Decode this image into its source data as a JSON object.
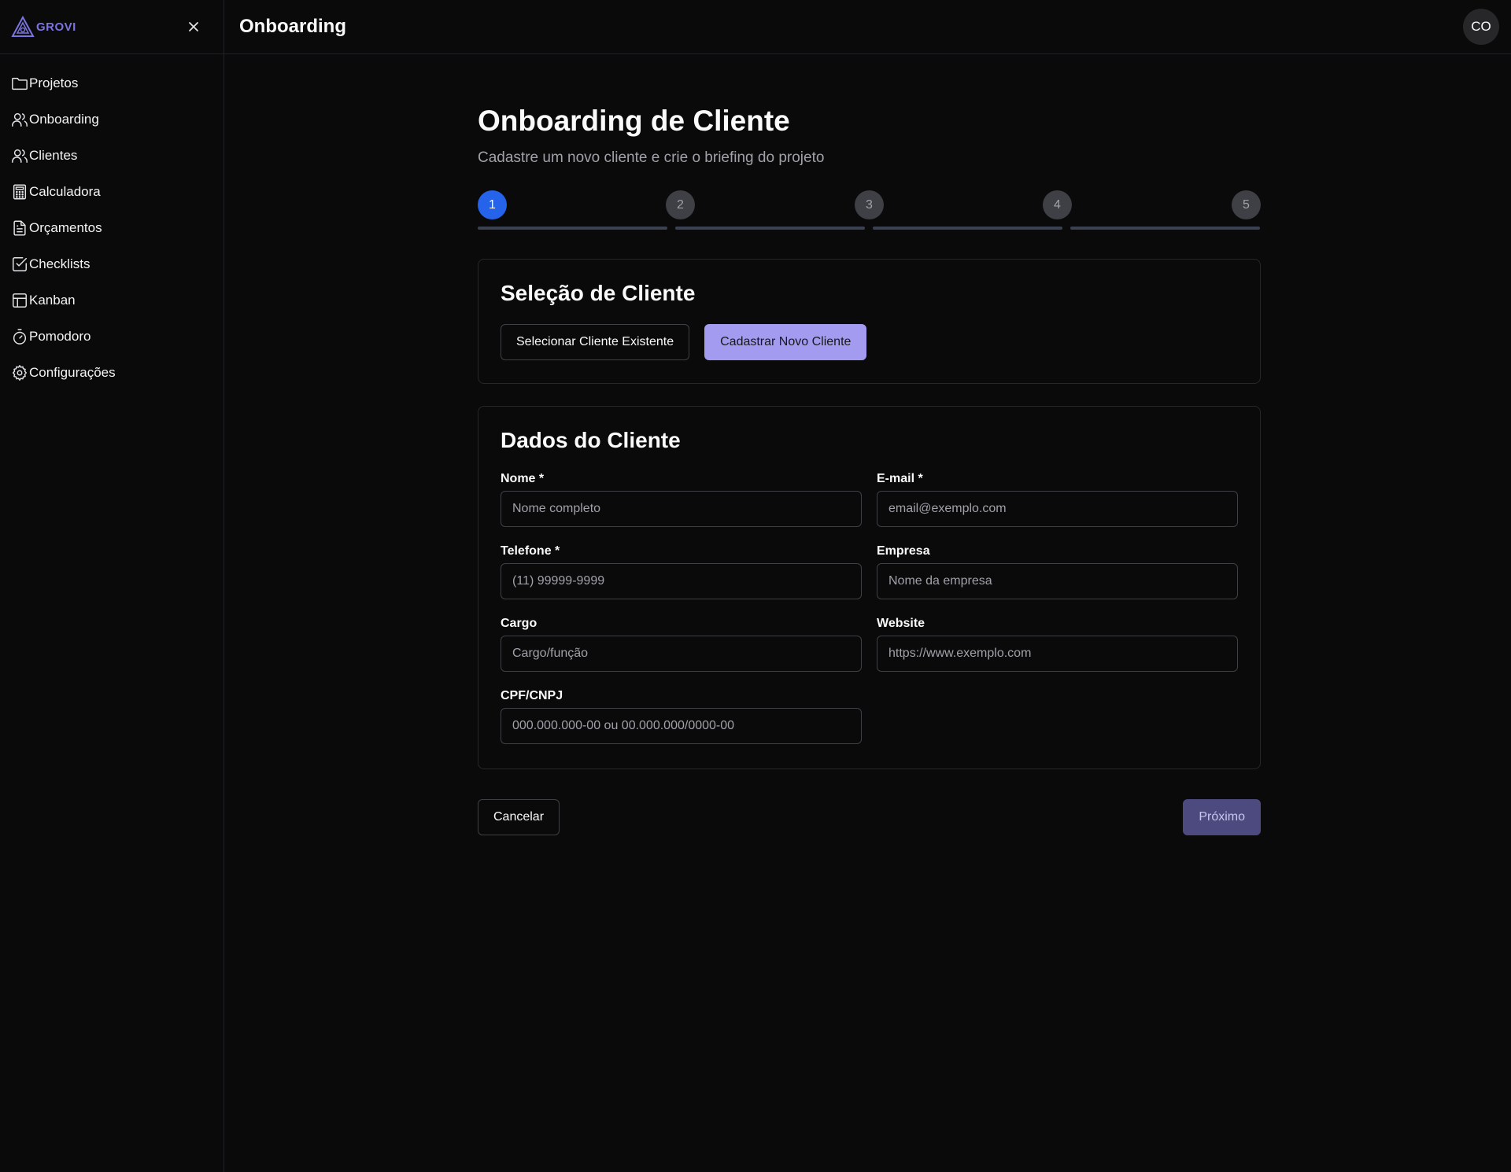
{
  "app": {
    "logo_text": "GROVI"
  },
  "sidebar": {
    "items": [
      {
        "label": "Projetos",
        "icon": "folder-icon"
      },
      {
        "label": "Onboarding",
        "icon": "users-icon"
      },
      {
        "label": "Clientes",
        "icon": "users-icon"
      },
      {
        "label": "Calculadora",
        "icon": "calculator-icon"
      },
      {
        "label": "Orçamentos",
        "icon": "file-text-icon"
      },
      {
        "label": "Checklists",
        "icon": "check-square-icon"
      },
      {
        "label": "Kanban",
        "icon": "layout-icon"
      },
      {
        "label": "Pomodoro",
        "icon": "timer-icon"
      },
      {
        "label": "Configurações",
        "icon": "gear-icon"
      }
    ]
  },
  "topbar": {
    "title": "Onboarding",
    "avatar_initials": "CO"
  },
  "page": {
    "title": "Onboarding de Cliente",
    "subtitle": "Cadastre um novo cliente e crie o briefing do projeto"
  },
  "stepper": {
    "steps": [
      "1",
      "2",
      "3",
      "4",
      "5"
    ],
    "active": 1
  },
  "client_selection": {
    "title": "Seleção de Cliente",
    "existing_label": "Selecionar Cliente Existente",
    "new_label": "Cadastrar Novo Cliente"
  },
  "client_data": {
    "title": "Dados do Cliente",
    "fields": {
      "nome": {
        "label": "Nome *",
        "placeholder": "Nome completo",
        "value": ""
      },
      "email": {
        "label": "E-mail *",
        "placeholder": "email@exemplo.com",
        "value": ""
      },
      "telefone": {
        "label": "Telefone *",
        "placeholder": "(11) 99999-9999",
        "value": ""
      },
      "empresa": {
        "label": "Empresa",
        "placeholder": "Nome da empresa",
        "value": ""
      },
      "cargo": {
        "label": "Cargo",
        "placeholder": "Cargo/função",
        "value": ""
      },
      "website": {
        "label": "Website",
        "placeholder": "https://www.exemplo.com",
        "value": ""
      },
      "cpf_cnpj": {
        "label": "CPF/CNPJ",
        "placeholder": "000.000.000-00 ou 00.000.000/0000-00",
        "value": ""
      }
    }
  },
  "actions": {
    "cancel_label": "Cancelar",
    "next_label": "Próximo"
  },
  "colors": {
    "background": "#0a0a0a",
    "accent": "#a29bf0",
    "step_active": "#2563eb",
    "next_disabled": "#4d4a80"
  }
}
